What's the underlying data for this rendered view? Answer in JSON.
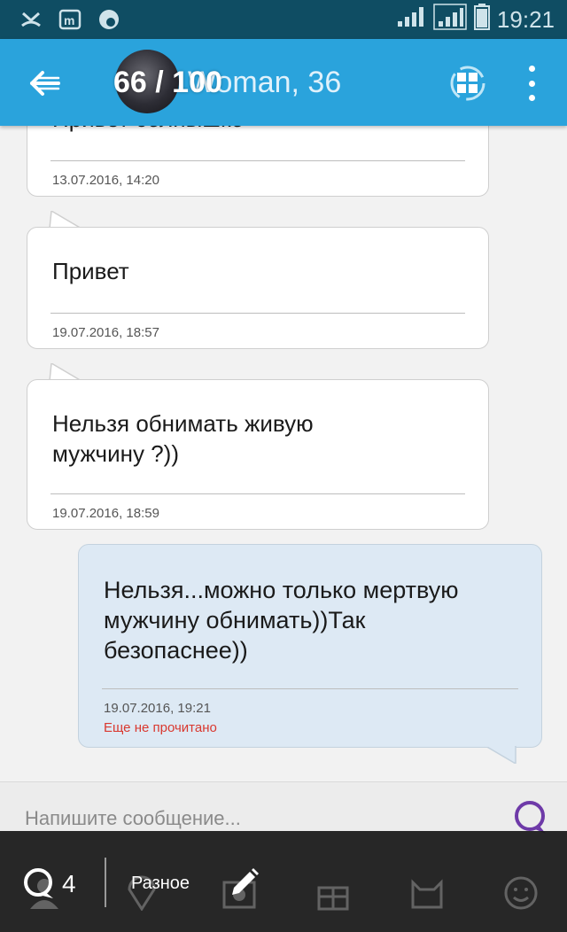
{
  "status_bar": {
    "time": "19:21",
    "icons": [
      "missed-call-icon",
      "mail-m-icon",
      "notification-icon",
      "signal-icon",
      "signal-4g-icon",
      "battery-icon"
    ]
  },
  "header": {
    "contact_name": "Woman, 36",
    "progress_text": "66 / 100"
  },
  "messages": [
    {
      "text": "Привет солнышко",
      "timestamp": "13.07.2016, 14:20",
      "direction": "in"
    },
    {
      "text": "Привет",
      "timestamp": "19.07.2016, 18:57",
      "direction": "in"
    },
    {
      "text_lines": [
        "Нельзя обнимать живую",
        "мужчину ?))"
      ],
      "timestamp": "19.07.2016, 18:59",
      "direction": "in"
    },
    {
      "text_lines": [
        "Нельзя...можно только мертвую",
        "мужчину обнимать))Так",
        "безопаснее))"
      ],
      "timestamp": "19.07.2016, 19:21",
      "status": "Еще не прочитано",
      "direction": "out"
    }
  ],
  "input": {
    "placeholder": "Напишите сообщение..."
  },
  "bottom_bar": {
    "chat_count": "4",
    "label": "Разное"
  },
  "colors": {
    "app_bar": "#2aa3dc",
    "status_bar": "#0f4d63",
    "outgoing_bubble": "#dde9f4",
    "unread": "#d9382f",
    "send_icon": "#6e3aa8"
  }
}
